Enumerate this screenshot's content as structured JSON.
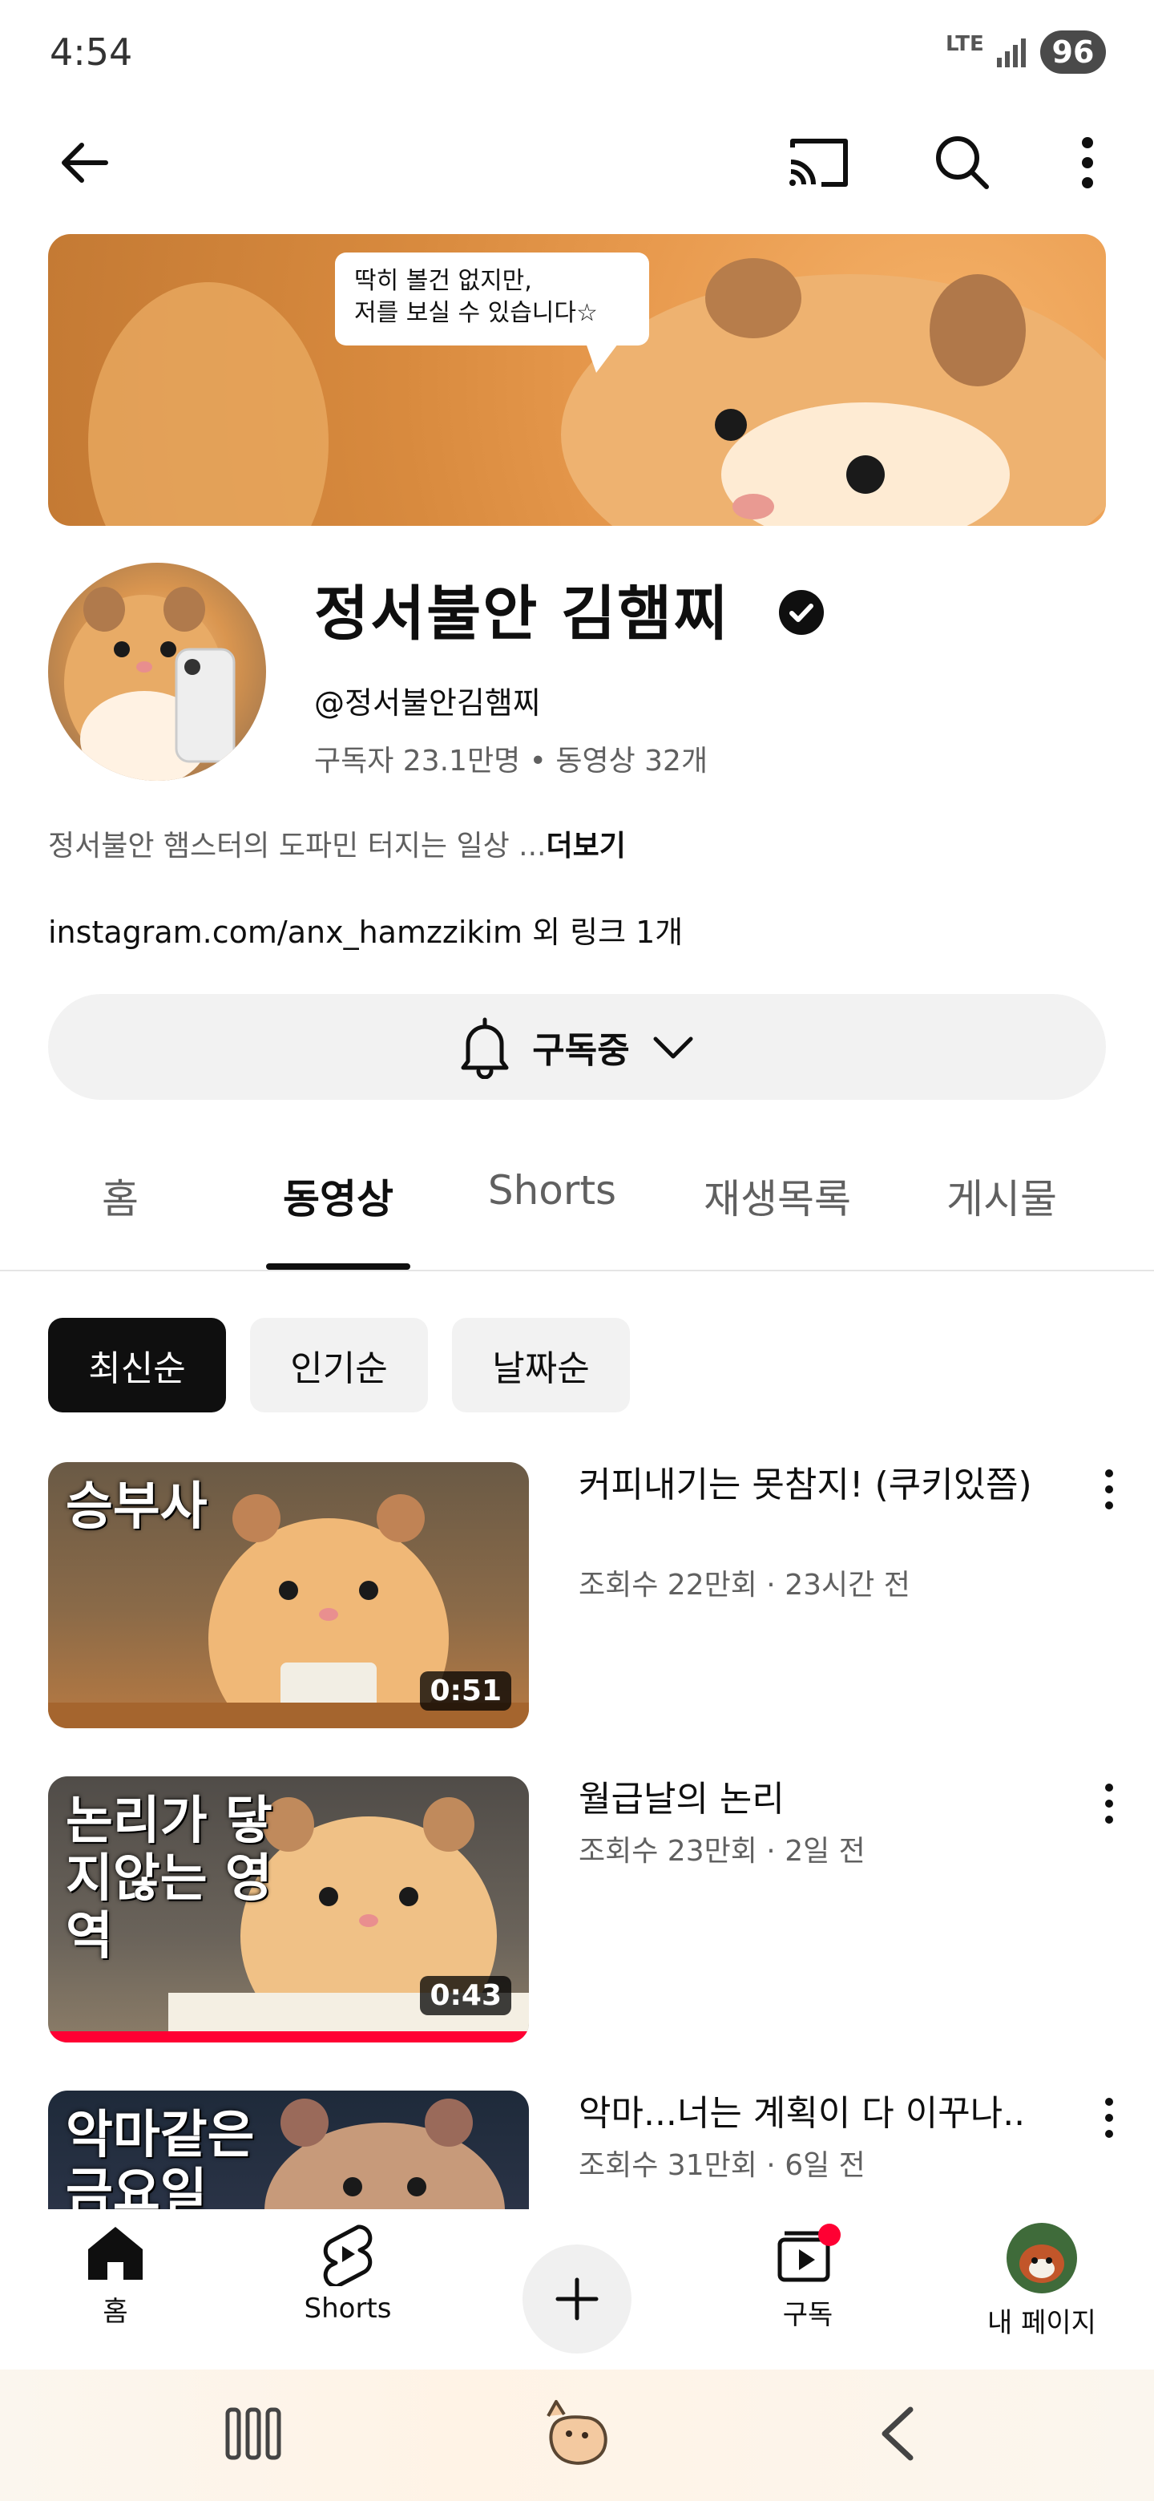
{
  "status_bar": {
    "time": "4:54",
    "network": "LTE",
    "battery": "96"
  },
  "banner": {
    "bubble_line1": "딱히 볼건 없지만,",
    "bubble_line2": "저를 보실 수 있습니다☆"
  },
  "channel": {
    "name": "정서불안 김햄찌",
    "handle": "@정서불안김햄찌",
    "subscribers": "구독자 23.1만명",
    "videos": "동영상 32개",
    "description": "정서불안 햄스터의 도파민 터지는 일상 ...",
    "more": "더보기",
    "link": "instagram.com/anx_hamzzikim",
    "link_extra": "외 링크 1개",
    "subscribe_label": "구독중"
  },
  "tabs": [
    {
      "label": "홈"
    },
    {
      "label": "동영상"
    },
    {
      "label": "Shorts"
    },
    {
      "label": "재생목록"
    },
    {
      "label": "게시물"
    }
  ],
  "sort_chips": [
    {
      "label": "최신순"
    },
    {
      "label": "인기순"
    },
    {
      "label": "날짜순"
    }
  ],
  "videos": [
    {
      "thumb_text": "승부사",
      "duration": "0:51",
      "title": "커피내기는 못참지! (쿠키있쯤)",
      "views": "조회수 22만회",
      "age": "23시간 전"
    },
    {
      "thumb_text": "논리가 닿지않는 영역",
      "duration": "0:43",
      "title": "월급날의 논리",
      "views": "조회수 23만회",
      "age": "2일 전"
    },
    {
      "thumb_text": "악마같은 금요일",
      "duration": "",
      "title": "악마...너는 계획이 다 이꾸나..",
      "views": "조회수 31만회",
      "age": "6일 전"
    }
  ],
  "bottom_nav": [
    {
      "label": "홈"
    },
    {
      "label": "Shorts"
    },
    {
      "label": "구독"
    },
    {
      "label": "내 페이지"
    }
  ],
  "colors": {
    "accent_red": "#ff0033",
    "text_primary": "#0f0f0f",
    "text_secondary": "#606060",
    "chip_bg": "#f2f2f2"
  }
}
